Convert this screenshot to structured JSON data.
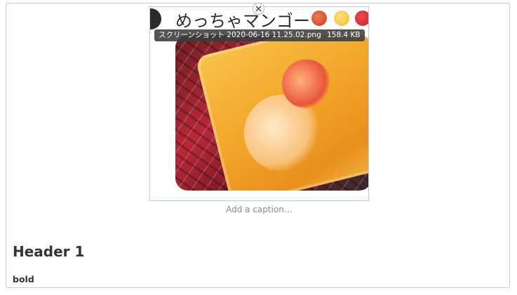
{
  "figure": {
    "embedded_title": "めっちゃマンゴー",
    "filename": "スクリーンショット 2020-06-16 11.25.02.png",
    "filesize": "158.4 KB",
    "emojis": [
      "mango-emoji",
      "face-emoji",
      "heart-emoji"
    ]
  },
  "caption": {
    "placeholder": "Add a caption…"
  },
  "content": {
    "header": "Header 1",
    "bold_text": "bold"
  },
  "icons": {
    "close": "close-icon"
  }
}
